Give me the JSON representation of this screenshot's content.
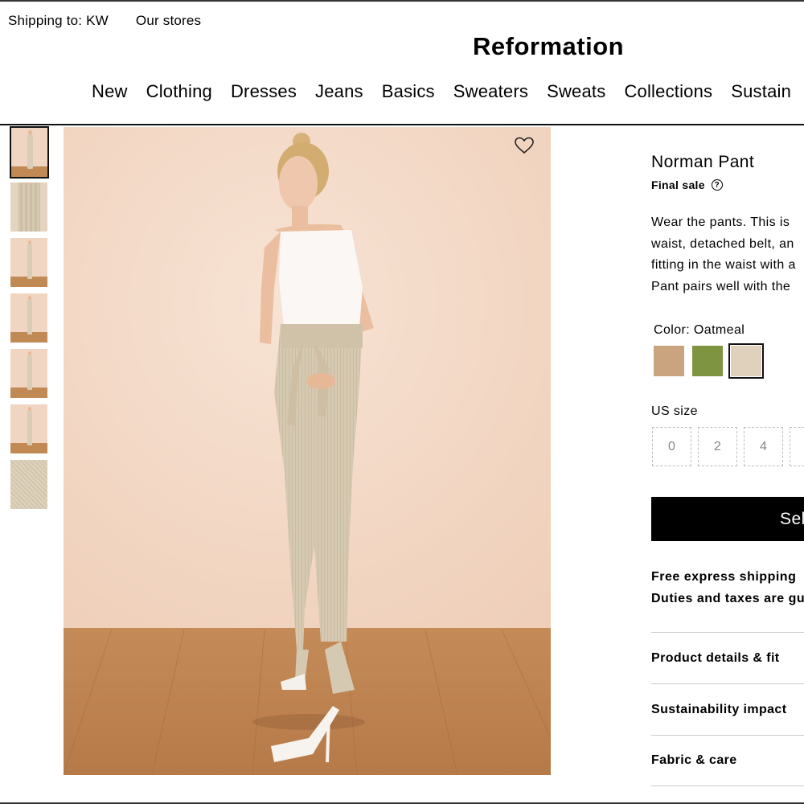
{
  "utility": {
    "shipping": "Shipping to: KW",
    "stores": "Our stores"
  },
  "brand": {
    "logo": "Reformation"
  },
  "nav": [
    "New",
    "Clothing",
    "Dresses",
    "Jeans",
    "Basics",
    "Sweaters",
    "Sweats",
    "Collections",
    "Sustain"
  ],
  "gallery": {
    "thumbnails": [
      "full-length",
      "waist-detail",
      "front",
      "side",
      "back",
      "model-alt",
      "fabric-swatch"
    ],
    "active_index": 0
  },
  "product": {
    "title": "Norman Pant",
    "final_sale": "Final sale",
    "help_glyph": "?",
    "description_lines": [
      "Wear the pants. This is",
      "waist, detached belt, an",
      "fitting in the waist with a",
      "Pant pairs well with the"
    ],
    "color_label": "Color: Oatmeal",
    "swatches": [
      {
        "name": "Tan",
        "color": "#c9a47e"
      },
      {
        "name": "Green",
        "color": "#7e9440"
      },
      {
        "name": "Oatmeal",
        "color": "#e0d1bd",
        "selected": true
      }
    ],
    "size_label": "US size",
    "sizes": [
      "0",
      "2",
      "4",
      ""
    ],
    "select_button": "Sel",
    "shipping_lines": [
      "Free express shipping",
      "Duties and taxes are gu"
    ],
    "accordions": [
      "Product details & fit",
      "Sustainability impact",
      "Fabric & care"
    ]
  },
  "colors": {
    "accent": "#000000",
    "wall": "#f2d9c7",
    "floor": "#b97d4b"
  },
  "icons": {
    "wishlist": "heart-outline-icon",
    "help": "question-circle-icon"
  }
}
